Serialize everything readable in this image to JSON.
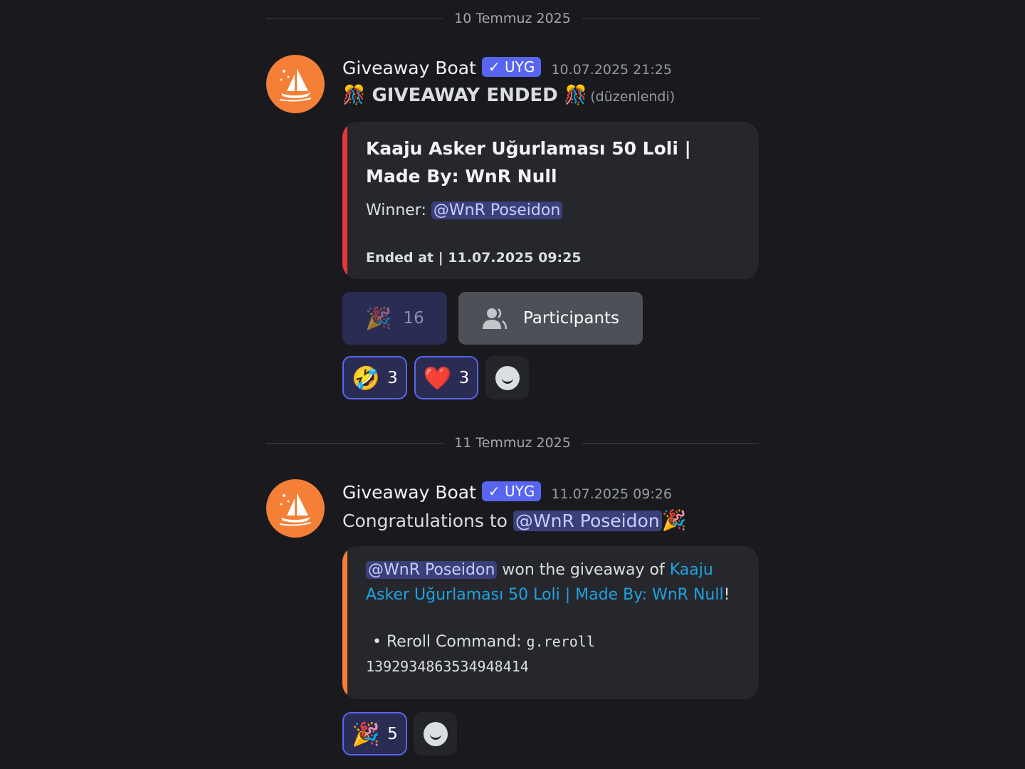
{
  "dividers": [
    "10 Temmuz 2025",
    "11 Temmuz 2025"
  ],
  "messages": [
    {
      "author": "Giveaway Boat",
      "badge": "✓ UYG",
      "timestamp": "10.07.2025 21:25",
      "content": "GIVEAWAY ENDED",
      "edited": "(düzenlendi)",
      "embed": {
        "accent": "#e5383b",
        "title": "Kaaju Asker Uğurlaması 50 Loli | Made By: WnR Null",
        "winner_label": "Winner:",
        "winner": "@WnR Poseidon",
        "footer": "Ended at | 11.07.2025 09:25"
      },
      "buttons": {
        "entries_count": "16",
        "participants": "Participants"
      },
      "reactions": [
        {
          "emoji": "🤣",
          "count": "3"
        },
        {
          "emoji": "❤️",
          "count": "3"
        }
      ]
    },
    {
      "author": "Giveaway Boat",
      "badge": "✓ UYG",
      "timestamp": "11.07.2025 09:26",
      "content_prefix": "Congratulations to",
      "mention": "@WnR Poseidon",
      "emoji": "🎉",
      "embed": {
        "accent": "#f57f36",
        "mention": "@WnR Poseidon",
        "text": "won the giveaway of",
        "link": "Kaaju Asker Uğurlaması 50 Loli | Made By: WnR Null",
        "end": "!",
        "reroll_label": "• Reroll Command:",
        "reroll_code": "g.reroll",
        "reroll_id": "1392934863534948414"
      },
      "reactions": [
        {
          "emoji": "🎉",
          "count": "5"
        }
      ]
    }
  ],
  "colors": {
    "background": "#1a1a1e",
    "brand": "#5865f2",
    "avatar": "#f57f36"
  }
}
